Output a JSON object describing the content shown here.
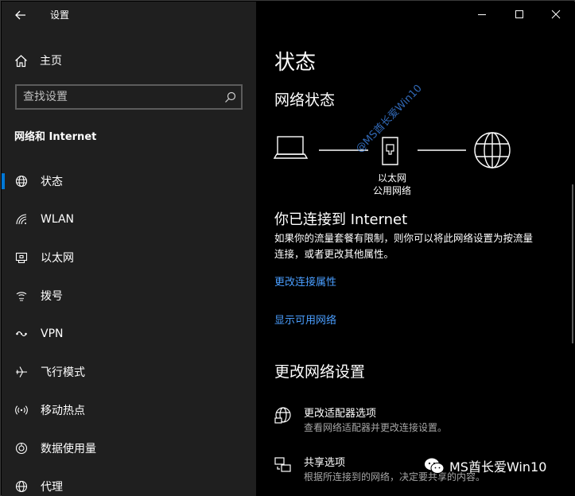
{
  "app": {
    "title": "设置"
  },
  "left": {
    "home_label": "主页",
    "search_placeholder": "查找设置",
    "section_title": "网络和 Internet",
    "nav": [
      {
        "label": "状态",
        "icon": "globe-icon",
        "active": true
      },
      {
        "label": "WLAN",
        "icon": "wifi-icon",
        "active": false
      },
      {
        "label": "以太网",
        "icon": "ethernet-icon",
        "active": false
      },
      {
        "label": "拨号",
        "icon": "dialup-icon",
        "active": false
      },
      {
        "label": "VPN",
        "icon": "vpn-icon",
        "active": false
      },
      {
        "label": "飞行模式",
        "icon": "airplane-icon",
        "active": false
      },
      {
        "label": "移动热点",
        "icon": "hotspot-icon",
        "active": false
      },
      {
        "label": "数据使用量",
        "icon": "data-usage-icon",
        "active": false
      },
      {
        "label": "代理",
        "icon": "globe-icon",
        "active": false
      }
    ]
  },
  "main": {
    "title": "状态",
    "network_status_heading": "网络状态",
    "adapter_name": "以太网",
    "network_type": "公用网络",
    "watermark": "@MS酋长爱Win10",
    "connected_title": "你已连接到 Internet",
    "connected_desc_line1": "如果你的流量套餐有限制，则你可以将此网络设置为按流量",
    "connected_desc_line2": "连接，或者更改其他属性。",
    "link_change_props": "更改连接属性",
    "link_show_networks": "显示可用网络",
    "change_settings_heading": "更改网络设置",
    "options": [
      {
        "title": "更改适配器选项",
        "desc": "查看网络适配器并更改连接设置。",
        "icon": "adapter-icon"
      },
      {
        "title": "共享选项",
        "desc": "根据所连接到的网络，决定要共享的内容。",
        "icon": "sharing-icon"
      }
    ],
    "wechat_label": "MS酋长爱Win10"
  },
  "colors": {
    "accent": "#0078d7",
    "link": "#4a9eff",
    "left_bg": "#1f1f1f",
    "right_bg": "#000000"
  }
}
